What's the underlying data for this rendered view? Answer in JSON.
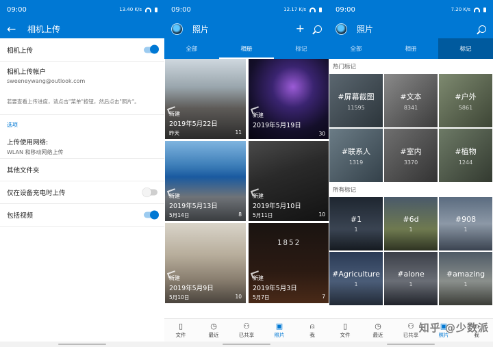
{
  "status": {
    "p1_time": "09:00",
    "p2_time": "09:00",
    "p3_time": "09:00",
    "p1_net": "13.40 K/s",
    "p2_net": "12.17 K/s",
    "p3_net": "7.20 K/s"
  },
  "settings_screen": {
    "title": "相机上传",
    "camera_upload_label": "相机上传",
    "account_label": "相机上传帐户",
    "account_value": "sweeneywang@outlook.com",
    "hint": "若要查看上传进度，请点击\"菜单\"按钮，然后点击\"照片\"。",
    "options_header": "选项",
    "network_label": "上传使用网络:",
    "network_value": "WLAN 和移动网络上传",
    "other_folders_label": "其他文件夹",
    "charging_only_label": "仅在设备充电时上传",
    "include_videos_label": "包括视频"
  },
  "photos_screen": {
    "title": "照片",
    "tabs": [
      "全部",
      "相册",
      "标记"
    ],
    "albums": [
      {
        "badge": "新建",
        "date": "2019年5月22日",
        "sub": "昨天",
        "count": "11"
      },
      {
        "badge": "新建",
        "date": "2019年5月19日",
        "sub": "",
        "count": "30"
      },
      {
        "badge": "新建",
        "date": "2019年5月13日",
        "sub": "5月14日",
        "count": "8"
      },
      {
        "badge": "新建",
        "date": "2019年5月10日",
        "sub": "5月11日",
        "count": "10"
      },
      {
        "badge": "新建",
        "date": "2019年5月9日",
        "sub": "5月10日",
        "count": "10"
      },
      {
        "badge": "新建",
        "date": "2019年5月3日",
        "sub": "5月7日",
        "count": "7"
      }
    ],
    "album_display_number": "1852"
  },
  "tags_screen": {
    "title": "照片",
    "tabs": [
      "全部",
      "相册",
      "标记"
    ],
    "hot_header": "热门标记",
    "all_header": "所有标记",
    "hot_tags": [
      {
        "name": "#屏幕截图",
        "count": "11595"
      },
      {
        "name": "#文本",
        "count": "8341"
      },
      {
        "name": "#户外",
        "count": "5861"
      },
      {
        "name": "#联系人",
        "count": "1319"
      },
      {
        "name": "#室内",
        "count": "3370"
      },
      {
        "name": "#植物",
        "count": "1244"
      }
    ],
    "all_tags": [
      {
        "name": "#1",
        "count": "1"
      },
      {
        "name": "#6d",
        "count": "1"
      },
      {
        "name": "#908",
        "count": "1"
      },
      {
        "name": "#Agriculture",
        "count": "1"
      },
      {
        "name": "#alone",
        "count": "1"
      },
      {
        "name": "#amazing",
        "count": "1"
      }
    ]
  },
  "bottom_nav": [
    "文件",
    "最近",
    "已共享",
    "照片",
    "我"
  ],
  "watermark": "知乎 @少数派"
}
